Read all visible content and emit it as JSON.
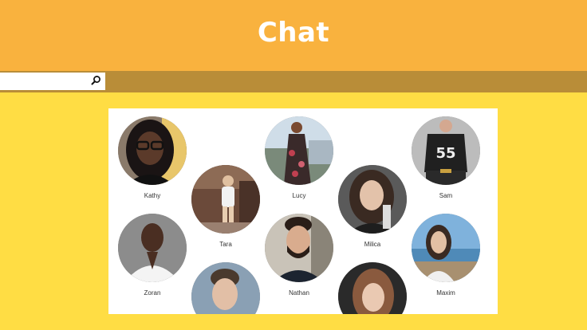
{
  "header": {
    "title": "Chat"
  },
  "search": {
    "placeholder": "",
    "value": ""
  },
  "contacts": [
    {
      "name": "Kathy"
    },
    {
      "name": "Tara"
    },
    {
      "name": "Lucy"
    },
    {
      "name": "Milica"
    },
    {
      "name": "Sam"
    },
    {
      "name": "Zoran"
    },
    {
      "name": "Nathan"
    },
    {
      "name": "Maxim"
    },
    {
      "name": ""
    },
    {
      "name": ""
    }
  ],
  "colors": {
    "page_background": "#FFDD44",
    "header_background": "#F9B23E",
    "search_strip": "#B98D38",
    "panel_background": "#FFFFFF"
  }
}
